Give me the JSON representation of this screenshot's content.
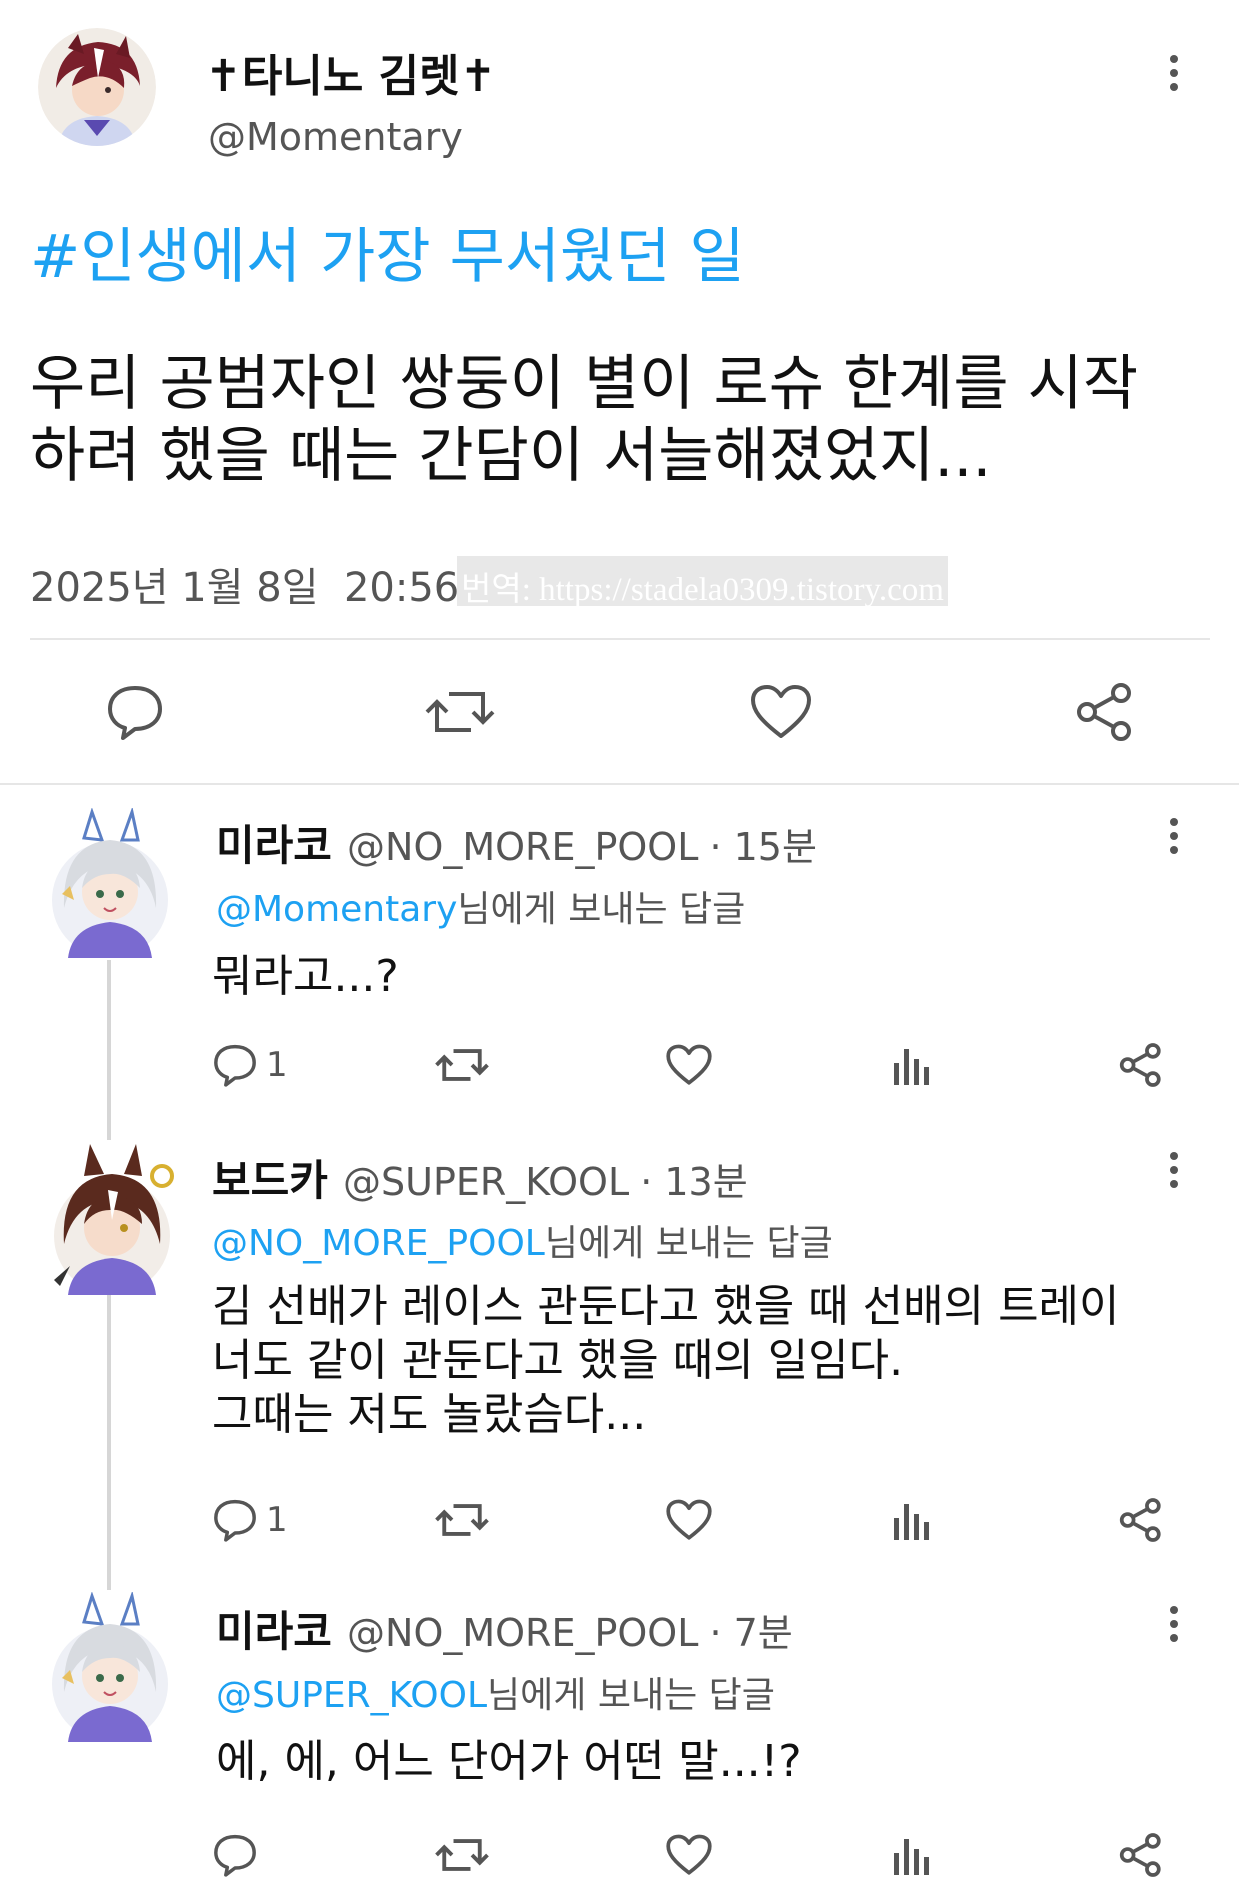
{
  "main_tweet": {
    "display_name": "✝타니노 김렛✝",
    "handle": "@Momentary",
    "hashtag": "#인생에서 가장 무서웠던 일",
    "body_line1": "우리 공범자인 쌍둥이 별이 로슈 한계를 시작",
    "body_line2": "하려 했을 때는 간담이 서늘해졌었지...",
    "timestamp": "2025년 1월 8일  20:56",
    "watermark": "번역: https://stadela0309.tistory.com"
  },
  "replies": [
    {
      "display_name": "미라코",
      "handle": "@NO_MORE_POOL",
      "time": "· 15분",
      "reply_to": "@Momentary",
      "reply_to_suffix": "님에게 보내는 답글",
      "body_lines": [
        "뭐라고...?"
      ],
      "reply_count": "1"
    },
    {
      "display_name": "보드카",
      "handle": "@SUPER_KOOL",
      "time": "· 13분",
      "reply_to": "@NO_MORE_POOL",
      "reply_to_suffix": "님에게 보내는 답글",
      "body_lines": [
        "김 선배가 레이스 관둔다고 했을 때 선배의 트레이",
        "너도 같이 관둔다고 했을 때의 일임다.",
        "그때는 저도 놀랐슴다..."
      ],
      "reply_count": "1"
    },
    {
      "display_name": "미라코",
      "handle": "@NO_MORE_POOL",
      "time": "· 7분",
      "reply_to": "@SUPER_KOOL",
      "reply_to_suffix": "님에게 보내는 답글",
      "body_lines": [
        "에, 에, 어느 단어가 어떤 말...!?"
      ],
      "reply_count": ""
    }
  ],
  "icons": {
    "reply": "speech-bubble-icon",
    "retweet": "retweet-icon",
    "like": "heart-icon",
    "share": "share-icon",
    "views": "bar-chart-icon",
    "more": "vertical-dots-icon"
  },
  "colors": {
    "accent": "#1da1f2",
    "text": "#111111",
    "muted": "#555555",
    "divider": "#e6e6e6"
  }
}
